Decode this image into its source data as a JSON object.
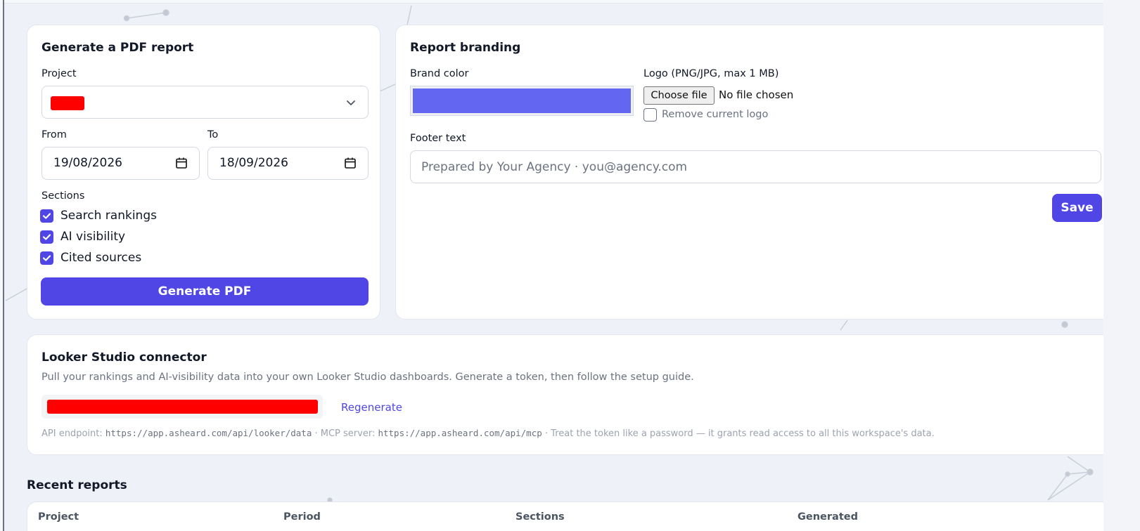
{
  "pdf_report": {
    "title": "Generate a PDF report",
    "project_label": "Project",
    "from_label": "From",
    "from_value": "19/08/2026",
    "to_label": "To",
    "to_value": "18/09/2026",
    "sections_label": "Sections",
    "sections": [
      {
        "label": "Search rankings",
        "checked": true
      },
      {
        "label": "AI visibility",
        "checked": true
      },
      {
        "label": "Cited sources",
        "checked": true
      }
    ],
    "generate_label": "Generate PDF"
  },
  "branding": {
    "title": "Report branding",
    "brand_color_label": "Brand color",
    "brand_color": "#6366f1",
    "logo_label": "Logo (PNG/JPG, max 1 MB)",
    "choose_file_label": "Choose file",
    "file_status": "No file chosen",
    "remove_logo_label": "Remove current logo",
    "footer_label": "Footer text",
    "footer_placeholder": "Prepared by Your Agency · you@agency.com",
    "save_label": "Save"
  },
  "looker": {
    "title": "Looker Studio connector",
    "description": "Pull your rankings and AI-visibility data into your own Looker Studio dashboards. Generate a token, then follow the setup guide.",
    "regenerate_label": "Regenerate",
    "api_endpoint_label": "API endpoint: ",
    "api_endpoint_url": "https://app.asheard.com/api/looker/data",
    "mcp_label": " · MCP server: ",
    "mcp_url": "https://app.asheard.com/api/mcp",
    "warning": " · Treat the token like a password — it grants read access to all this workspace's data."
  },
  "recent_reports": {
    "title": "Recent reports",
    "columns": [
      "Project",
      "Period",
      "Sections",
      "Generated"
    ]
  },
  "colors": {
    "accent": "#4f46e5",
    "brand_swatch": "#6366f1",
    "redaction": "#ff0000"
  }
}
